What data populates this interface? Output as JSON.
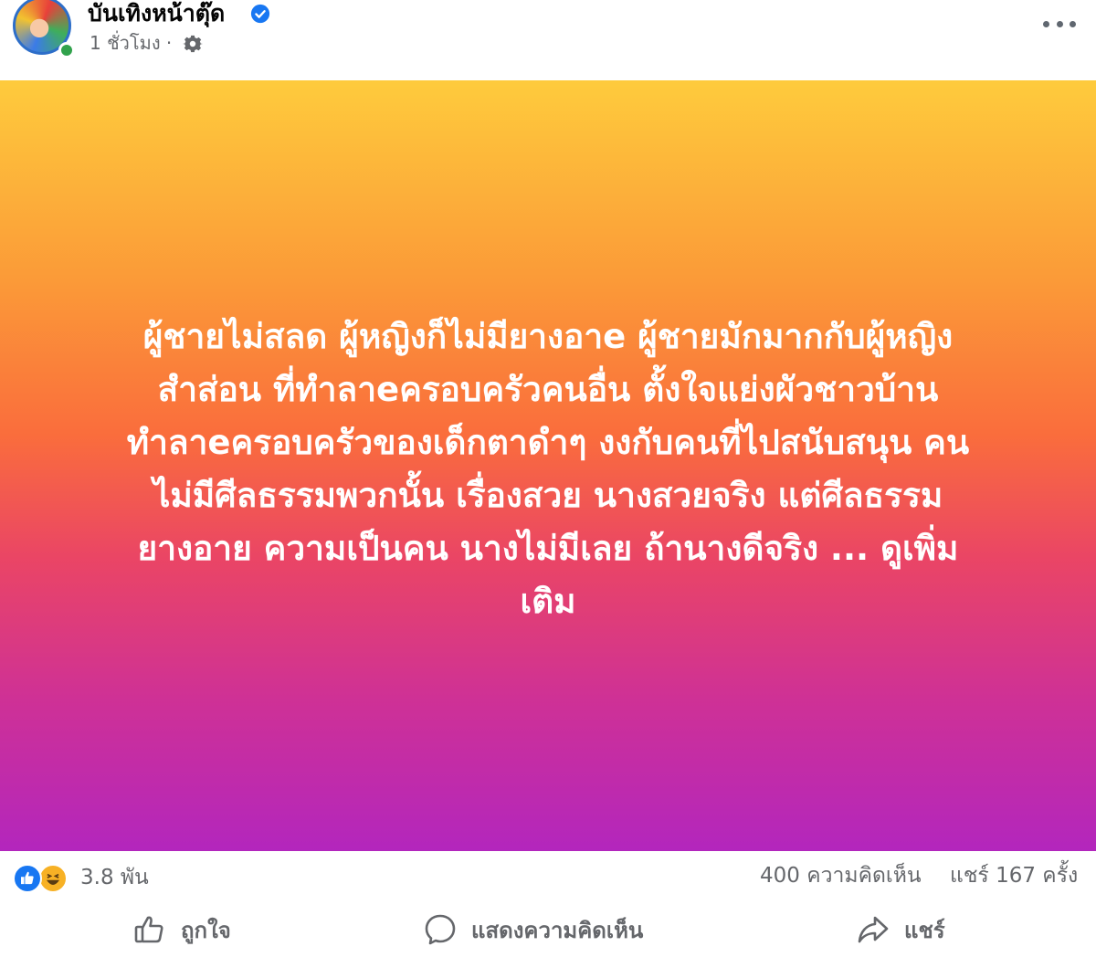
{
  "header": {
    "page_name": "บันเทิงหน้าตุ๊ด",
    "time": "1 ชั่วโมง ·",
    "icons": [
      "verified-badge-icon",
      "gear-icon",
      "more-options-icon"
    ]
  },
  "post": {
    "text": "ผู้ชายไม่สลด ผู้หญิงก็ไม่มียางอาe ผู้ชายมักมากกับผู้หญิง\nสำส่อน ที่ทำลาeครอบครัวคนอื่น ตั้งใจแย่งผัวชาวบ้าน\nทำลาeครอบครัวของเด็กตาดำๆ งงกับคนที่ไปสนับสนุน คน\nไม่มีศีลธรรมพวกนั้น เรื่องสวย นางสวยจริง แต่ศีลธรรม\nยางอาย ความเป็นคน นางไม่มีเลย ถ้านางดีจริง ... ดูเพิ่ม\nเติม",
    "background_colors": [
      "#fecb3c",
      "#fa6d3c",
      "#b326bd"
    ]
  },
  "stats": {
    "reactions": "3.8 พัน",
    "comments": "400 ความคิดเห็น",
    "shares": "แชร์ 167 ครั้ง"
  },
  "actions": {
    "like": "ถูกใจ",
    "comment": "แสดงความคิดเห็น",
    "share": "แชร์"
  }
}
